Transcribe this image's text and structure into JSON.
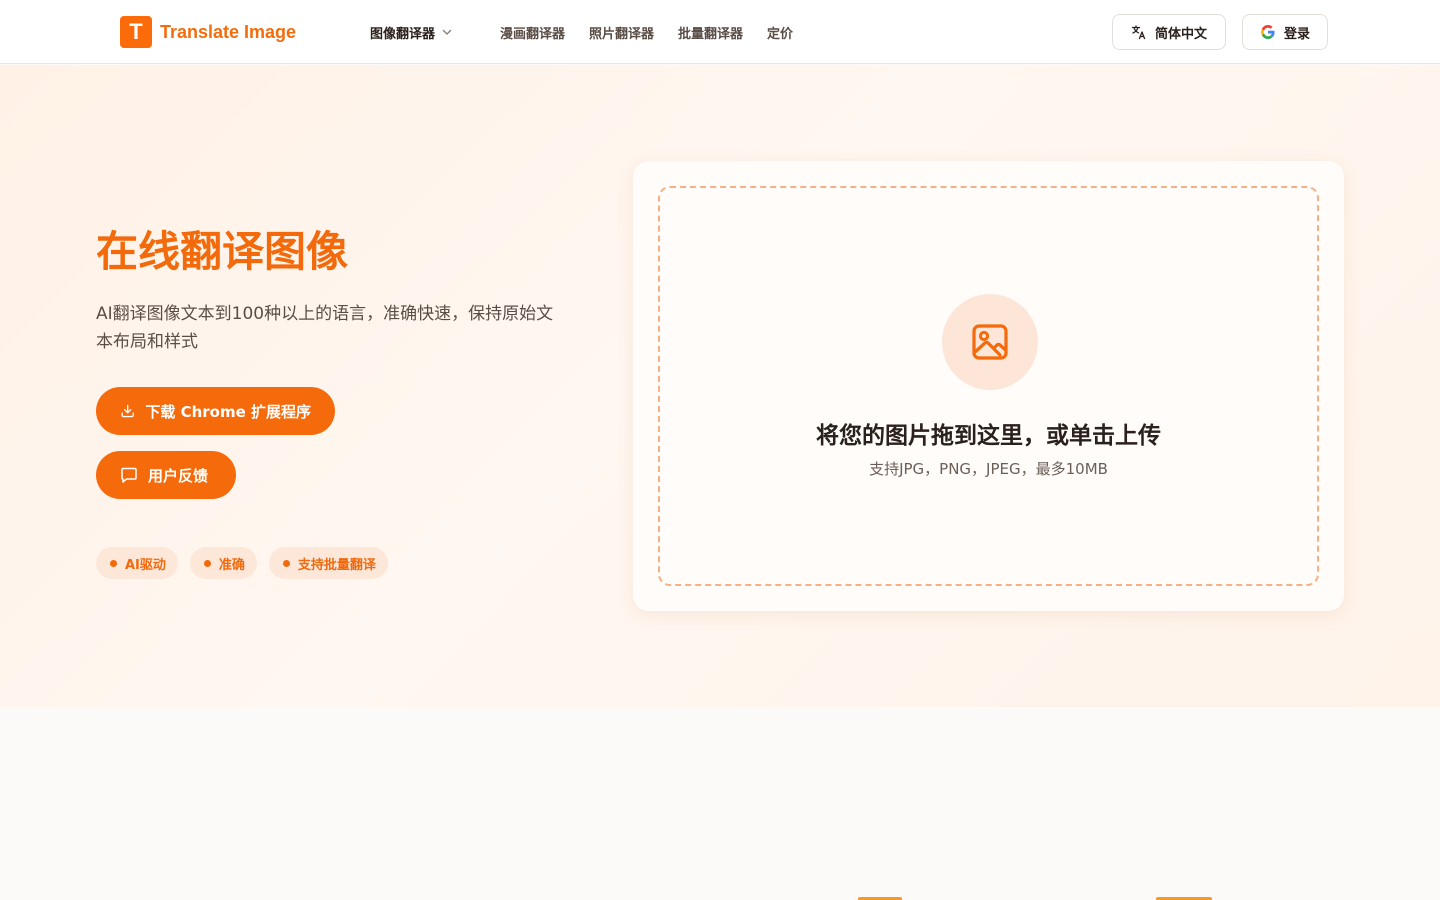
{
  "header": {
    "logo_letter": "T",
    "brand": "Translate Image",
    "nav_dropdown": "图像翻译器",
    "nav_links": [
      "漫画翻译器",
      "照片翻译器",
      "批量翻译器",
      "定价"
    ],
    "lang_button": "简体中文",
    "login_button": "登录"
  },
  "hero": {
    "title": "在线翻译图像",
    "subtitle": "AI翻译图像文本到100种以上的语言，准确快速，保持原始文本布局和样式",
    "download_button": "下载 Chrome 扩展程序",
    "feedback_button": "用户反馈",
    "tags": [
      "AI驱动",
      "准确",
      "支持批量翻译"
    ]
  },
  "upload": {
    "title": "将您的图片拖到这里，或单击上传",
    "subtitle": "支持JPG，PNG，JPEG，最多10MB"
  },
  "colors": {
    "accent": "#f56a0a",
    "accent_soft": "#fde7d8",
    "dashed_border": "#f7b084"
  },
  "icons": [
    "translate-icon",
    "google-icon",
    "chevron-down-icon",
    "download-icon",
    "message-icon",
    "image-icon"
  ]
}
